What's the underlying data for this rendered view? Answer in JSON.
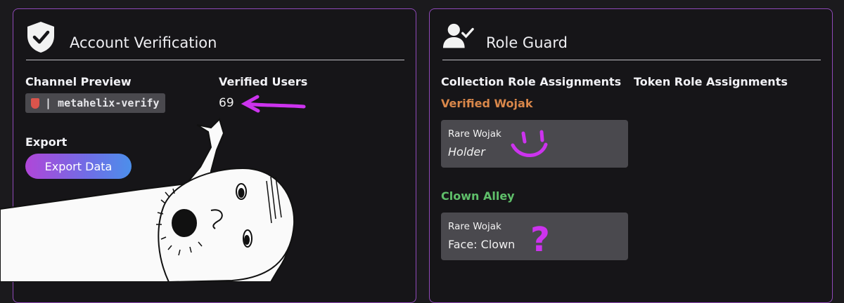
{
  "account_panel": {
    "title": "Account Verification",
    "channel_preview_label": "Channel Preview",
    "channel_name": "| metahelix-verify",
    "verified_users_label": "Verified Users",
    "verified_users_count": "69",
    "export_label": "Export",
    "export_button": "Export Data"
  },
  "role_panel": {
    "title": "Role Guard",
    "collection_heading": "Collection Role Assignments",
    "token_heading": "Token Role Assignments",
    "roles": [
      {
        "role_name": "Verified Wojak",
        "color": "#d9874a",
        "collection": "Rare Wojak",
        "trait": "Holder"
      },
      {
        "role_name": "Clown Alley",
        "color": "#5fbf6a",
        "collection": "Rare Wojak",
        "trait": "Face: Clown"
      }
    ]
  },
  "annotations": {
    "question_mark": "?",
    "accent_color": "#cc33ee"
  },
  "colors": {
    "panel_border": "#8f49b8",
    "background": "#161518",
    "card": "#4a494e"
  }
}
